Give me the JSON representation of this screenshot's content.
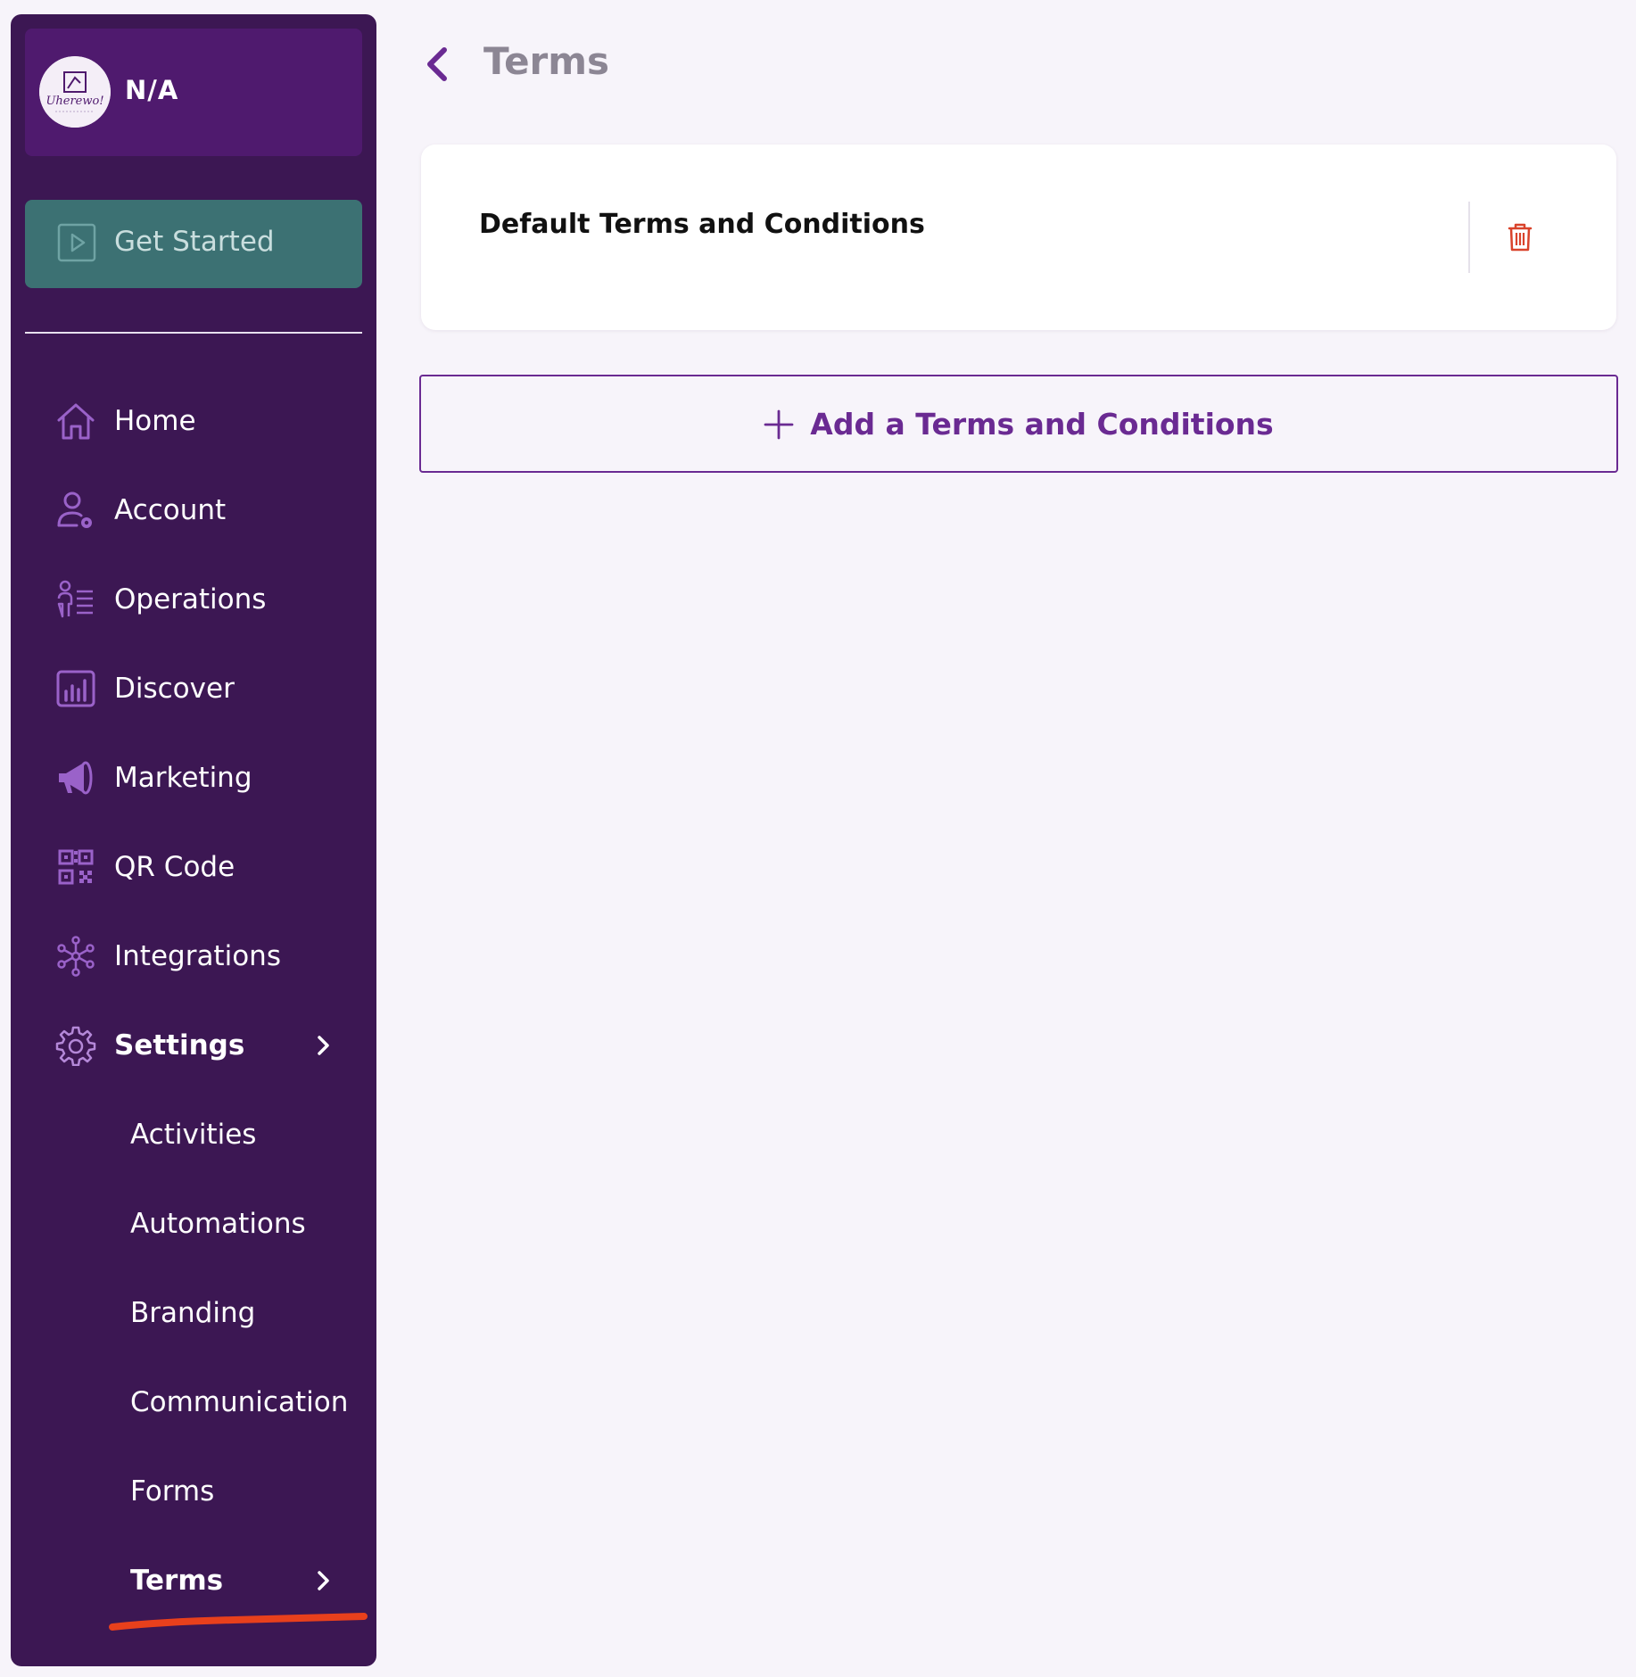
{
  "org": {
    "name": "N/A",
    "logo_text": "Uherewo!"
  },
  "get_started": {
    "label": "Get Started"
  },
  "sidebar": {
    "items": [
      {
        "label": "Home",
        "icon": "home-icon"
      },
      {
        "label": "Account",
        "icon": "account-settings-icon"
      },
      {
        "label": "Operations",
        "icon": "operations-icon"
      },
      {
        "label": "Discover",
        "icon": "bar-chart-icon"
      },
      {
        "label": "Marketing",
        "icon": "megaphone-icon"
      },
      {
        "label": "QR Code",
        "icon": "qr-code-icon"
      },
      {
        "label": "Integrations",
        "icon": "integrations-icon"
      },
      {
        "label": "Settings",
        "icon": "gear-icon",
        "active": true
      }
    ],
    "settings_sub": [
      {
        "label": "Activities"
      },
      {
        "label": "Automations"
      },
      {
        "label": "Branding"
      },
      {
        "label": "Communication"
      },
      {
        "label": "Forms"
      },
      {
        "label": "Terms",
        "active": true
      }
    ]
  },
  "header": {
    "title": "Terms"
  },
  "terms_list": [
    {
      "title": "Default Terms and Conditions"
    }
  ],
  "add_button": {
    "label": "Add a Terms and Conditions"
  },
  "colors": {
    "sidebar_bg": "#3c1753",
    "org_card_bg": "#4f1a6e",
    "get_started_bg": "#3c7173",
    "accent_purple": "#6a2a92",
    "delete_red": "#d9432b",
    "annotation_red": "#e8401c",
    "page_bg": "#f7f4fa"
  }
}
